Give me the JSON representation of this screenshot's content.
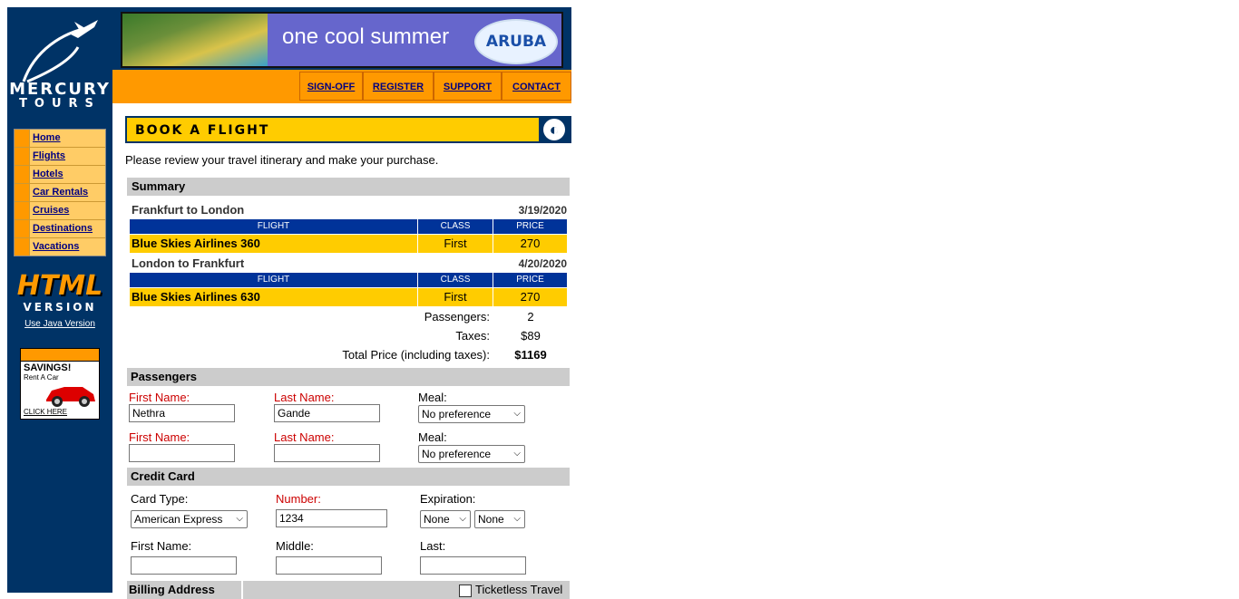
{
  "brand": {
    "line1": "MERCURY",
    "line2": "TOURS"
  },
  "sidebar": {
    "nav": [
      {
        "label": "Home"
      },
      {
        "label": "Flights"
      },
      {
        "label": "Hotels"
      },
      {
        "label": "Car Rentals"
      },
      {
        "label": "Cruises"
      },
      {
        "label": "Destinations"
      },
      {
        "label": "Vacations"
      }
    ],
    "html_version": {
      "line1": "HTML",
      "line2": "VERSION",
      "link": "Use Java Version"
    },
    "ad": {
      "line1": "SAVINGS!",
      "line2": "Rent A Car",
      "line3": "CLICK HERE"
    }
  },
  "banner": {
    "text": "one cool summer",
    "logo_text": "ARUBA"
  },
  "topnav": {
    "signoff": "SIGN-OFF",
    "register": "REGISTER",
    "support": "SUPPORT",
    "contact": "CONTACT"
  },
  "page": {
    "heading": "BOOK A FLIGHT",
    "intro": "Please review your travel itinerary and make your purchase.",
    "summary_title": "Summary",
    "columns": {
      "flight": "FLIGHT",
      "class": "CLASS",
      "price": "PRICE"
    },
    "outbound": {
      "route": "Frankfurt to London",
      "date": "3/19/2020",
      "flight": "Blue Skies Airlines 360",
      "class": "First",
      "price": "270"
    },
    "inbound": {
      "route": "London to Frankfurt",
      "date": "4/20/2020",
      "flight": "Blue Skies Airlines 630",
      "class": "First",
      "price": "270"
    },
    "passengers_label": "Passengers:",
    "passengers_value": "2",
    "taxes_label": "Taxes:",
    "taxes_value": "$89",
    "total_label": "Total Price (including taxes):",
    "total_value": "$1169"
  },
  "passengers": {
    "title": "Passengers",
    "first_name_label": "First Name:",
    "last_name_label": "Last Name:",
    "meal_label": "Meal:",
    "rows": [
      {
        "first": "Nethra",
        "last": "Gande",
        "meal": "No preference"
      },
      {
        "first": "",
        "last": "",
        "meal": "No preference"
      }
    ]
  },
  "credit_card": {
    "title": "Credit Card",
    "card_type_label": "Card Type:",
    "card_type_value": "American Express",
    "number_label": "Number:",
    "number_value": "1234",
    "expiration_label": "Expiration:",
    "exp_month": "None",
    "exp_year": "None",
    "first_label": "First Name:",
    "middle_label": "Middle:",
    "last_label": "Last:",
    "first_value": "",
    "middle_value": "",
    "last_value": ""
  },
  "billing": {
    "title": "Billing Address",
    "ticketless": "Ticketless Travel"
  },
  "colors": {
    "navy": "#003366",
    "orange": "#ff9900",
    "yellow": "#ffcc00",
    "blue_header": "#003399",
    "required_red": "#cc0000"
  }
}
